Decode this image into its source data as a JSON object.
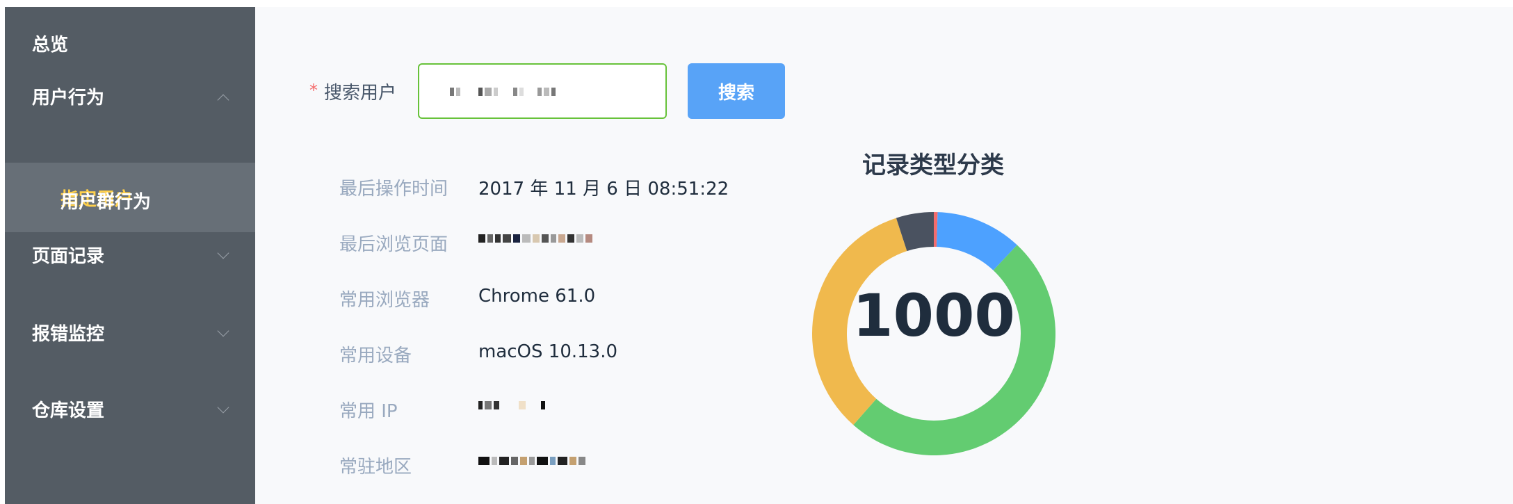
{
  "sidebar": {
    "items": [
      {
        "label": "总览"
      },
      {
        "label": "用户行为"
      },
      {
        "label": "指定用户"
      },
      {
        "label": "用户群行为"
      },
      {
        "label": "页面记录"
      },
      {
        "label": "报错监控"
      },
      {
        "label": "仓库设置"
      }
    ],
    "active_color": "#ffd04b"
  },
  "search": {
    "required_mark": "*",
    "label": "搜索用户",
    "button_label": "搜索"
  },
  "info": {
    "last_op_time": {
      "label": "最后操作时间",
      "value": "2017 年 11 月 6 日 08:51:22"
    },
    "last_page": {
      "label": "最后浏览页面"
    },
    "browser": {
      "label": "常用浏览器",
      "value": "Chrome 61.0"
    },
    "device": {
      "label": "常用设备",
      "value": "macOS 10.13.0"
    },
    "ip": {
      "label": "常用 IP"
    },
    "region": {
      "label": "常驻地区"
    }
  },
  "chart_data": {
    "type": "pie",
    "title": "记录类型分类",
    "center_value": "1000",
    "slices": [
      {
        "value": 0.5,
        "color": "#f56c6c"
      },
      {
        "value": 11.5,
        "color": "#4da1ff"
      },
      {
        "value": 49.5,
        "color": "#63cc71"
      },
      {
        "value": 33.5,
        "color": "#f0b94d"
      },
      {
        "value": 5.0,
        "color": "#4a5260"
      }
    ]
  }
}
